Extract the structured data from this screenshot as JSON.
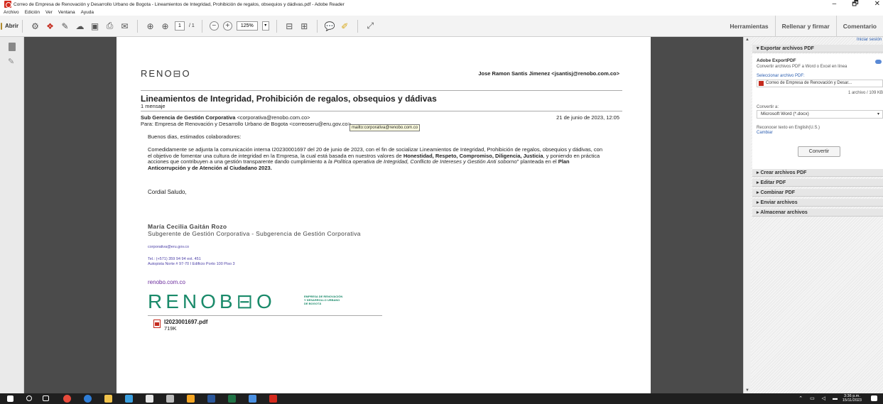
{
  "window": {
    "title": "Correo de Empresa de Renovación y Desarrollo Urbano de Bogota - Lineamientos de Integridad, Prohibición de regalos, obsequios y dádivas.pdf - Adobe Reader",
    "minimize": "–",
    "maximize": "🗗",
    "close": "✕"
  },
  "menu": [
    "Archivo",
    "Edición",
    "Ver",
    "Ventana",
    "Ayuda"
  ],
  "toolbar": {
    "open_label": "Abrir",
    "page_current": "1",
    "page_total": "/ 1",
    "zoom": "125%",
    "zoom_caret": "▾",
    "zoom_out": "−",
    "zoom_in": "+",
    "tabs": [
      "Herramientas",
      "Rellenar y firmar",
      "Comentario"
    ]
  },
  "email": {
    "logo_small": "RENO⊟O",
    "account": "Jose Ramon Santis Jimenez <jsantisj@renobo.com.co>",
    "subject": "Lineamientos de Integridad, Prohibición de regalos, obsequios y dádivas",
    "count": "1 mensaje",
    "from_name": "Sub Gerencia de Gestión Corporativa",
    "from_addr": "<corporativa@renobo.com.co>",
    "date": "21 de junio de 2023, 12:05",
    "to": "Para: Empresa de Renovación y Desarrollo Urbano de Bogota <correoseru@eru.gov.co>",
    "tooltip": "mailto:corporativa@renobo.com.co",
    "greeting": "Buenos dias, estimados colaboradores:",
    "para_1": "Comedidamente se adjunta la comunicación interna I20230001697 del 20 de junio de 2023, con el fin de socializar Lineamientos de Integridad, Prohibición de regalos, obsequios y dádivas, con el objetivo de fomentar una cultura de integridad en la Empresa, la cual está basada en nuestros valores de",
    "values_bold": "Honestidad, Respeto, Compromiso, Diligencia, Justicia",
    "para_2": ", y poniendo en práctica acciones que contribuyen a una gestión transparente dando cumplimiento a",
    "policy_italic": "la Política operativa de Integridad, Conflicto de Intereses y Gestión Anti soborno",
    "para_3": "\" planteada en el",
    "plan_bold": "Plan Anticorrupción y de Atención al Ciudadano 2023.",
    "closing": "Cordial Saludo,",
    "sig_name": "María Cecilia Gaitán Rozo",
    "sig_title": "Subgerente de Gestión Corporativa - Subgerencia de Gestión Corporativa",
    "sig_email": "corporativa@eru.gov.co",
    "sig_tel": "Tel.: (+571) 359 94 94 ext. 451",
    "sig_addr": "Autopista Norte # 97-70 I Edificio Porto 100 Piso 3",
    "sig_url": "renobo.com.co",
    "logo_big": "RENOB⊟O",
    "logo_sub_1": "EMPRESA DE RENOVACIÓN",
    "logo_sub_2": "Y DESARROLLO URBANO",
    "logo_sub_3": "DE BOGOTÁ",
    "attachment_name": "I2023001697.pdf",
    "attachment_size": "719K"
  },
  "panel": {
    "login": "Iniciar sesión",
    "export_header": "▾  Exportar archivos PDF",
    "export_title": "Adobe ExportPDF",
    "export_desc": "Convertir archivos PDF a Word o Excel en línea",
    "select_label": "Seleccionar archivo PDF:",
    "selected_file": "Correo de Empresa de Renovación y Desar...",
    "file_count": "1 archivo / 109 KB",
    "convert_label": "Convertir a:",
    "convert_value": "Microsoft Word (*.docx)",
    "convert_caret": "▾",
    "ocr_label": "Reconocer texto en English(U.S.)",
    "change_link": "Cambiar",
    "convert_button": "Convertir",
    "sections": [
      "▸  Crear archivos PDF",
      "▸  Editar PDF",
      "▸  Combinar PDF",
      "▸  Enviar archivos",
      "▸  Almacenar archivos"
    ]
  },
  "taskbar": {
    "time": "3:36 p.m.",
    "date": "15/11/2023"
  }
}
